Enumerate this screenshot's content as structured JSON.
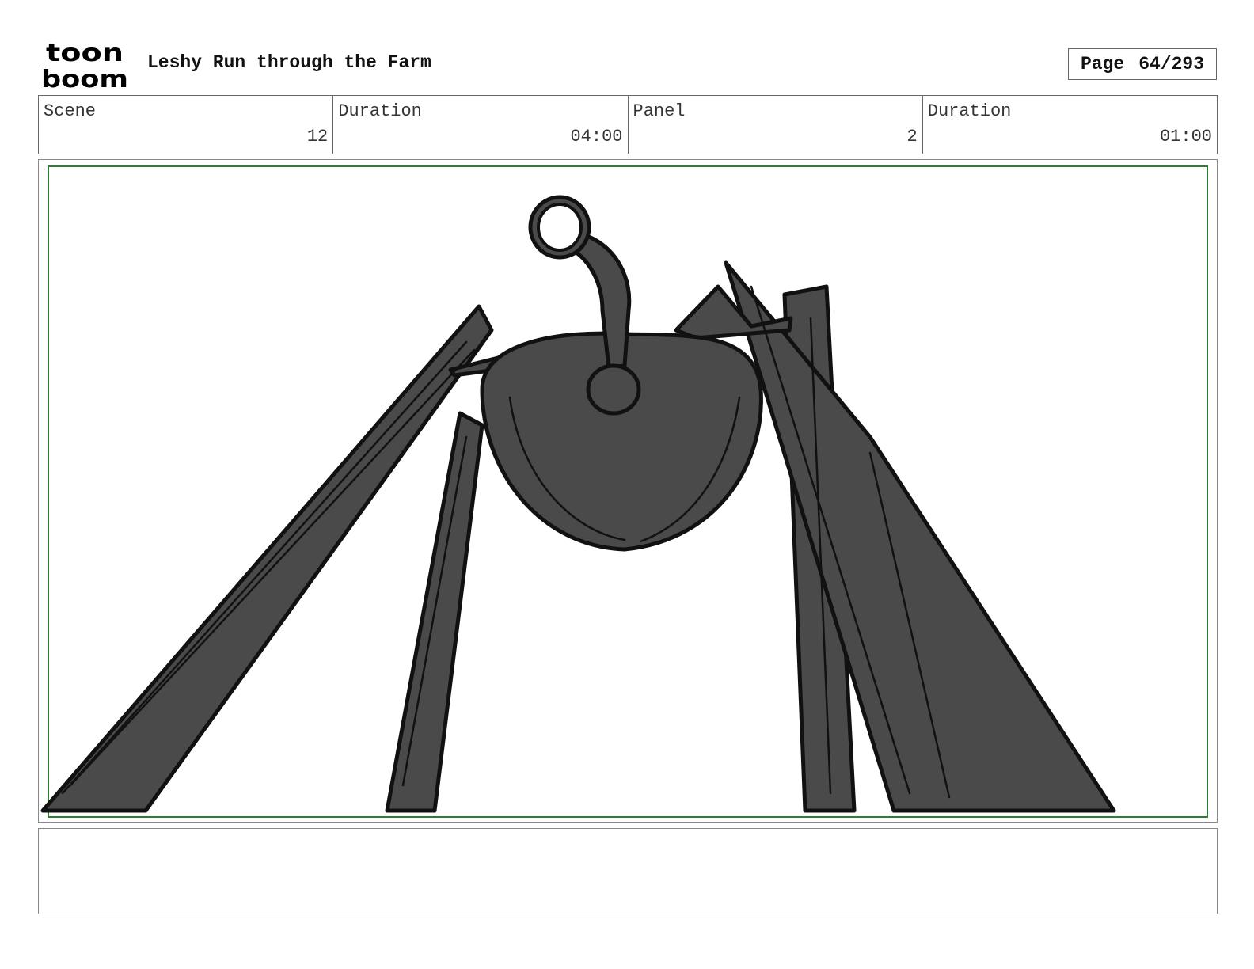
{
  "header": {
    "logo_line1": "toon",
    "logo_line2": "boom",
    "project_title": "Leshy Run through the Farm",
    "page_label": "Page",
    "page_number": "64/293"
  },
  "info": {
    "scene_label": "Scene",
    "scene_value": "12",
    "scene_duration_label": "Duration",
    "scene_duration_value": "04:00",
    "panel_label": "Panel",
    "panel_value": "2",
    "panel_duration_label": "Duration",
    "panel_duration_value": "01:00"
  },
  "panel": {
    "safe_frame_color": "#2e7d32",
    "sketch_fill_color": "#4a4a4a",
    "sketch_line_color": "#111111"
  },
  "notes": {
    "text": ""
  }
}
